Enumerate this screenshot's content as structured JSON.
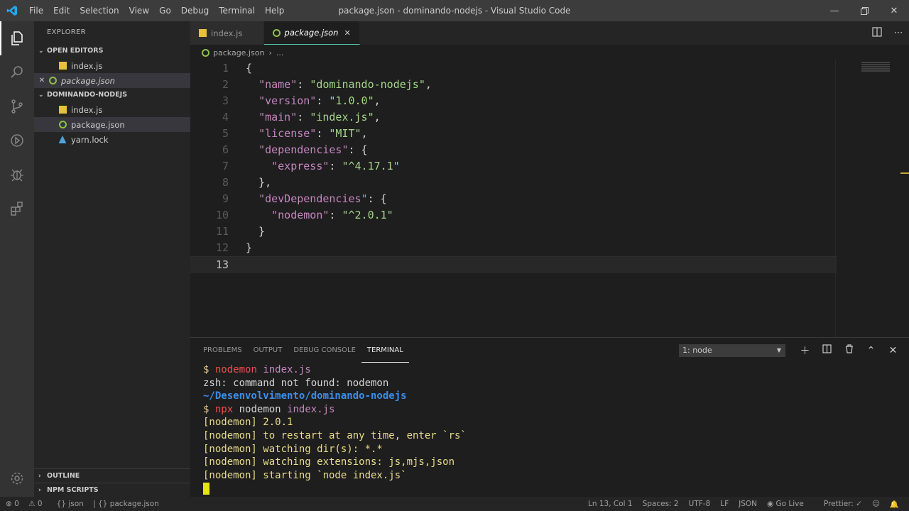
{
  "window": {
    "title": "package.json - dominando-nodejs - Visual Studio Code",
    "menu": [
      "File",
      "Edit",
      "Selection",
      "View",
      "Go",
      "Debug",
      "Terminal",
      "Help"
    ]
  },
  "sidebar": {
    "title": "EXPLORER",
    "open_editors": {
      "label": "OPEN EDITORS",
      "items": [
        {
          "label": "index.js",
          "icon": "js-file-icon"
        },
        {
          "label": "package.json",
          "icon": "json-file-icon"
        }
      ]
    },
    "project": {
      "label": "DOMINANDO-NODEJS",
      "items": [
        {
          "label": "index.js",
          "icon": "js-file-icon"
        },
        {
          "label": "package.json",
          "icon": "json-file-icon"
        },
        {
          "label": "yarn.lock",
          "icon": "yarn-file-icon"
        }
      ]
    },
    "outline_label": "OUTLINE",
    "npm_scripts_label": "NPM SCRIPTS"
  },
  "tabs": [
    {
      "label": "index.js",
      "active": false
    },
    {
      "label": "package.json",
      "active": true
    }
  ],
  "breadcrumb": {
    "file": "package.json",
    "rest": "..."
  },
  "editor": {
    "line_numbers": [
      "1",
      "2",
      "3",
      "4",
      "5",
      "6",
      "7",
      "8",
      "9",
      "10",
      "11",
      "12",
      "13"
    ],
    "current_line": 13
  },
  "code": {
    "name_key": "\"name\"",
    "name_val": "\"dominando-nodejs\"",
    "version_key": "\"version\"",
    "version_val": "\"1.0.0\"",
    "main_key": "\"main\"",
    "main_val": "\"index.js\"",
    "license_key": "\"license\"",
    "license_val": "\"MIT\"",
    "deps_key": "\"dependencies\"",
    "express_key": "\"express\"",
    "express_val": "\"^4.17.1\"",
    "devdeps_key": "\"devDependencies\"",
    "nodemon_key": "\"nodemon\"",
    "nodemon_val": "\"^2.0.1\""
  },
  "panel": {
    "tabs": [
      "PROBLEMS",
      "OUTPUT",
      "DEBUG CONSOLE",
      "TERMINAL"
    ],
    "active_tab": "TERMINAL",
    "terminal_select": "1: node"
  },
  "terminal": {
    "prompt": "$",
    "cmd1": "nodemon",
    "cmd1_arg": "index.js",
    "line2": "zsh: command not found: nodemon",
    "path": "~/Desenvolvimento/dominando-nodejs",
    "cmd2": "npx",
    "cmd2_rest": "nodemon",
    "cmd2_arg": "index.js",
    "out1": "[nodemon] 2.0.1",
    "out2": "[nodemon] to restart at any time, enter `rs`",
    "out3": "[nodemon] watching dir(s): *.*",
    "out4": "[nodemon] watching extensions: js,mjs,json",
    "out5": "[nodemon] starting `node index.js`"
  },
  "statusbar": {
    "errors": "0",
    "warnings": "0",
    "json_lang": "json",
    "file": "package.json",
    "position": "Ln 13, Col 1",
    "spaces": "Spaces: 2",
    "encoding": "UTF-8",
    "eol": "LF",
    "language": "JSON",
    "golive": "Go Live",
    "prettier": "Prettier: ✓"
  },
  "colors": {
    "accent": "#007acc",
    "keyword": "#c586c0",
    "string": "#a4d68a",
    "terminal_red": "#f14c4c",
    "terminal_path": "#3b8eea"
  }
}
